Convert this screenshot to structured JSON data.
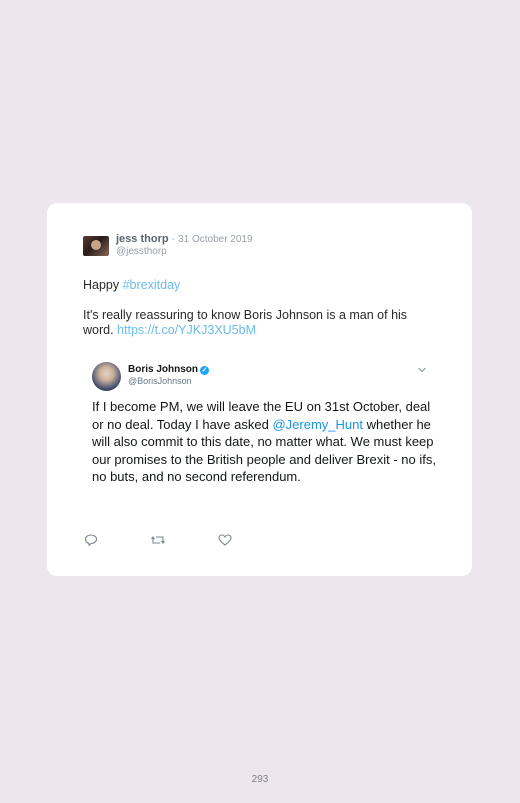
{
  "tweet": {
    "author_name": "jess thorp",
    "separator": "·",
    "date": "31 October 2019",
    "handle": "@jessthorp",
    "text_prefix": "Happy ",
    "hashtag": "#brexitday",
    "text_body": "It's really reassuring to know Boris Johnson is a man of his word. ",
    "link": "https://t.co/YJKJ3XU5bM"
  },
  "quoted": {
    "author_name": "Boris Johnson",
    "verified_mark": "✓",
    "handle": "@BorisJohnson",
    "text_part1": "If I become PM, we will leave the EU on 31st October, deal or no deal. Today I have asked ",
    "mention": "@Jeremy_Hunt",
    "text_part2": " whether he will also commit to this date, no matter what. We must keep our promises to the British people and deliver Brexit - no ifs, no buts, and no second referendum."
  },
  "actions": {
    "reply_icon": "reply-icon",
    "retweet_icon": "retweet-icon",
    "like_icon": "heart-icon"
  },
  "page": {
    "number": "293"
  },
  "colors": {
    "background": "#ede6ed",
    "link": "#6bbce8",
    "mention": "#1b95e0",
    "verified": "#1da1f2"
  }
}
